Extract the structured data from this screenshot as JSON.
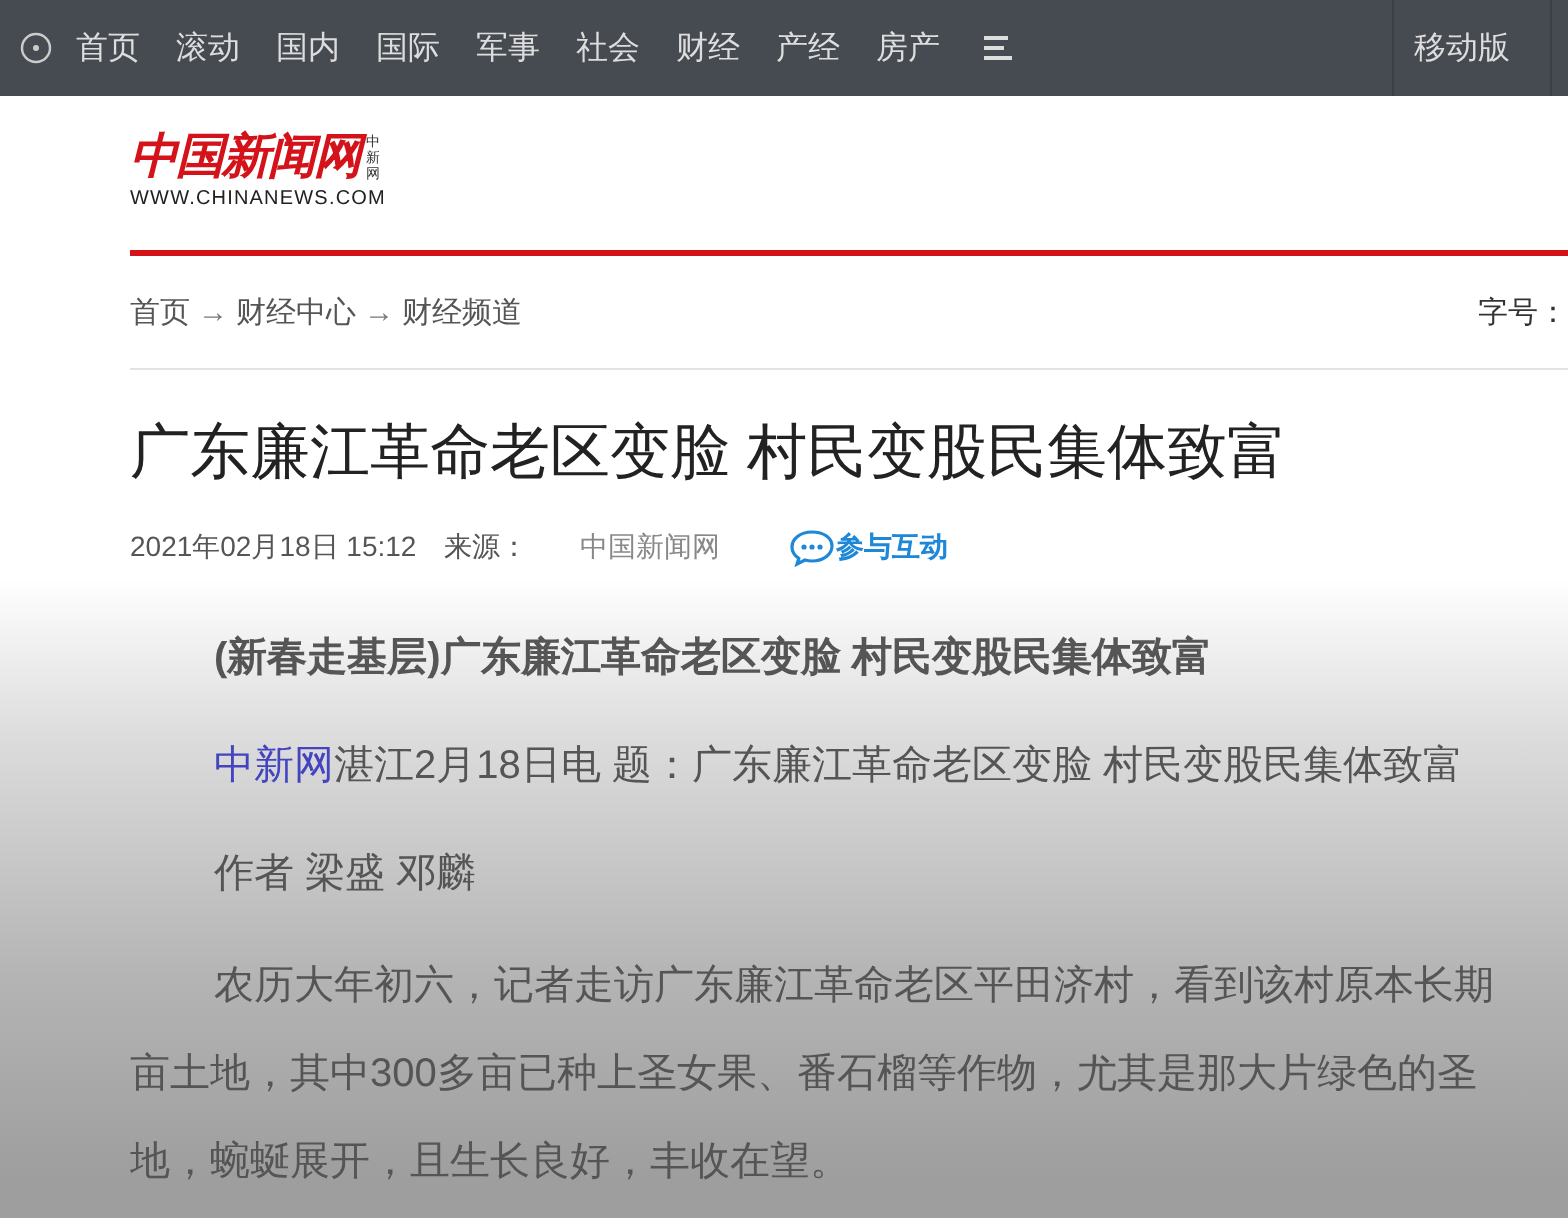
{
  "nav": {
    "items": [
      "首页",
      "滚动",
      "国内",
      "国际",
      "军事",
      "社会",
      "财经",
      "产经",
      "房产"
    ],
    "mobile_link": "移动版"
  },
  "logo": {
    "name": "中国新闻网",
    "side": "中新网",
    "url": "WWW.CHINANEWS.COM"
  },
  "breadcrumb": {
    "items": [
      "首页",
      "财经中心",
      "财经频道"
    ],
    "separator": "→",
    "font_size_label": "字号："
  },
  "article": {
    "title": "广东廉江革命老区变脸 村民变股民集体致富",
    "date": "2021年02月18日 15:12",
    "source_label": "来源：",
    "source": "中国新闻网",
    "interact": "参与互动",
    "lead": "(新春走基层)广东廉江革命老区变脸 村民变股民集体致富",
    "dateline": {
      "link": "中新网",
      "text": "湛江2月18日电 题：广东廉江革命老区变脸 村民变股民集体致富"
    },
    "author": "作者 梁盛 邓麟",
    "paragraph_lines": [
      "农历大年初六，记者走访广东廉江革命老区平田济村，看到该村原本长期",
      "亩土地，其中300多亩已种上圣女果、番石榴等作物，尤其是那大片绿色的圣",
      "地，蜿蜒展开，且生长良好，丰收在望。"
    ]
  }
}
